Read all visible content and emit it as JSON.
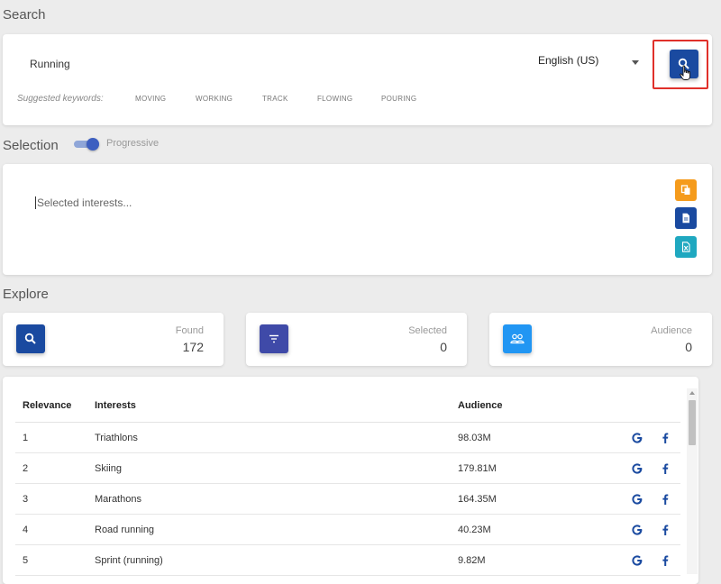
{
  "search": {
    "section_label": "Search",
    "input_value": "Running",
    "language": "English (US)",
    "suggested_label": "Suggested keywords:",
    "keywords": [
      "MOVING",
      "WORKING",
      "TRACK",
      "FLOWING",
      "POURING"
    ]
  },
  "selection": {
    "section_label": "Selection",
    "toggle_label": "Progressive",
    "placeholder": "Selected interests..."
  },
  "explore": {
    "section_label": "Explore",
    "stats": [
      {
        "label": "Found",
        "value": "172"
      },
      {
        "label": "Selected",
        "value": "0"
      },
      {
        "label": "Audience",
        "value": "0"
      }
    ]
  },
  "table": {
    "headers": [
      "Relevance",
      "Interests",
      "Audience"
    ],
    "rows": [
      {
        "relevance": "1",
        "interest": "Triathlons",
        "audience": "98.03M"
      },
      {
        "relevance": "2",
        "interest": "Skiing",
        "audience": "179.81M"
      },
      {
        "relevance": "3",
        "interest": "Marathons",
        "audience": "164.35M"
      },
      {
        "relevance": "4",
        "interest": "Road running",
        "audience": "40.23M"
      },
      {
        "relevance": "5",
        "interest": "Sprint (running)",
        "audience": "9.82M"
      }
    ]
  },
  "colors": {
    "primary": "#1a4aa0",
    "orange": "#f59b1c",
    "teal": "#1fa8c0",
    "indigo": "#3f4aa8",
    "sky": "#2196f3",
    "highlight": "#e0302a"
  }
}
